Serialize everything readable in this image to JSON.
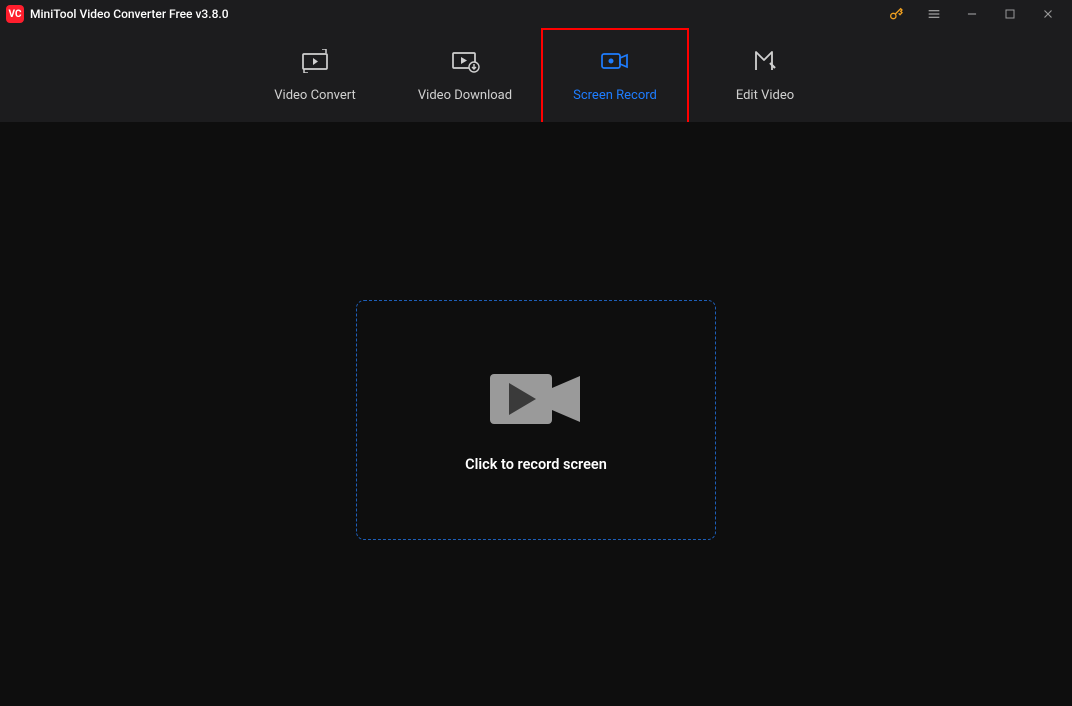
{
  "app": {
    "title": "MiniTool Video Converter Free v3.8.0",
    "logo_text": "VC"
  },
  "colors": {
    "accent_blue": "#1e7dff",
    "highlight_red": "#ff0000",
    "record_border": "#1e5fb8"
  },
  "tabs": [
    {
      "id": "video-convert",
      "label": "Video Convert",
      "active": false
    },
    {
      "id": "video-download",
      "label": "Video Download",
      "active": false
    },
    {
      "id": "screen-record",
      "label": "Screen Record",
      "active": true
    },
    {
      "id": "edit-video",
      "label": "Edit Video",
      "active": false
    }
  ],
  "main": {
    "record_prompt": "Click to record screen"
  },
  "icons": {
    "video_convert": "video-convert-icon",
    "video_download": "video-download-icon",
    "screen_record": "camera-icon",
    "edit_video": "edit-video-icon",
    "key": "key-icon",
    "menu": "menu-icon",
    "minimize": "minimize-icon",
    "maximize": "maximize-icon",
    "close": "close-icon"
  }
}
